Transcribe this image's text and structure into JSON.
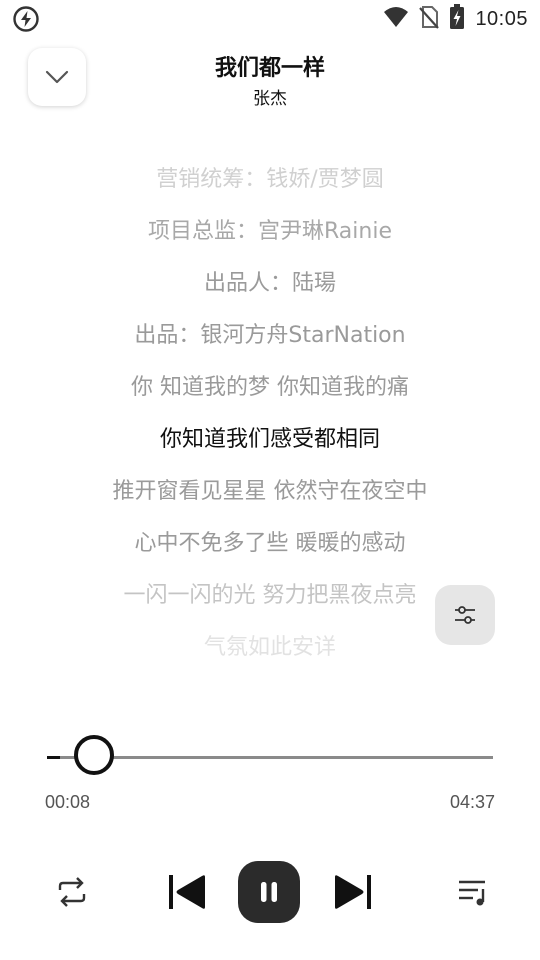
{
  "status_bar": {
    "time": "10:05",
    "icons": [
      "battery-saver-icon",
      "wifi-icon",
      "no-sim-icon",
      "battery-charging-icon"
    ]
  },
  "header": {
    "title": "我们都一样",
    "artist": "张杰",
    "collapse_icon": "chevron-down-icon"
  },
  "lyrics": {
    "lines": [
      {
        "text": "营销统筹：钱娇/贾梦圆",
        "color": "#d0d0d0"
      },
      {
        "text": "项目总监：宫尹琳Rainie",
        "color": "#a8a8a8"
      },
      {
        "text": "出品人：陆瑒",
        "color": "#9a9a9a"
      },
      {
        "text": "出品：银河方舟StarNation",
        "color": "#9a9a9a"
      },
      {
        "text": "你 知道我的梦 你知道我的痛",
        "color": "#9a9a9a"
      },
      {
        "text": "你知道我们感受都相同",
        "color": "#111111"
      },
      {
        "text": "推开窗看见星星 依然守在夜空中",
        "color": "#9a9a9a"
      },
      {
        "text": "心中不免多了些 暖暖的感动",
        "color": "#9a9a9a"
      },
      {
        "text": "一闪一闪的光 努力把黑夜点亮",
        "color": "#c4c4c4"
      },
      {
        "text": "气氛如此安详",
        "color": "#e2e2e2"
      }
    ],
    "active_index": 5
  },
  "adjust_button": {
    "icon": "adjust-sliders-icon"
  },
  "player": {
    "current_time": "00:08",
    "total_time": "04:37",
    "progress": 0.029,
    "controls": {
      "repeat": "repeat-icon",
      "previous": "skip-previous-icon",
      "play_pause": "pause-icon",
      "next": "skip-next-icon",
      "playlist": "playlist-icon"
    }
  }
}
